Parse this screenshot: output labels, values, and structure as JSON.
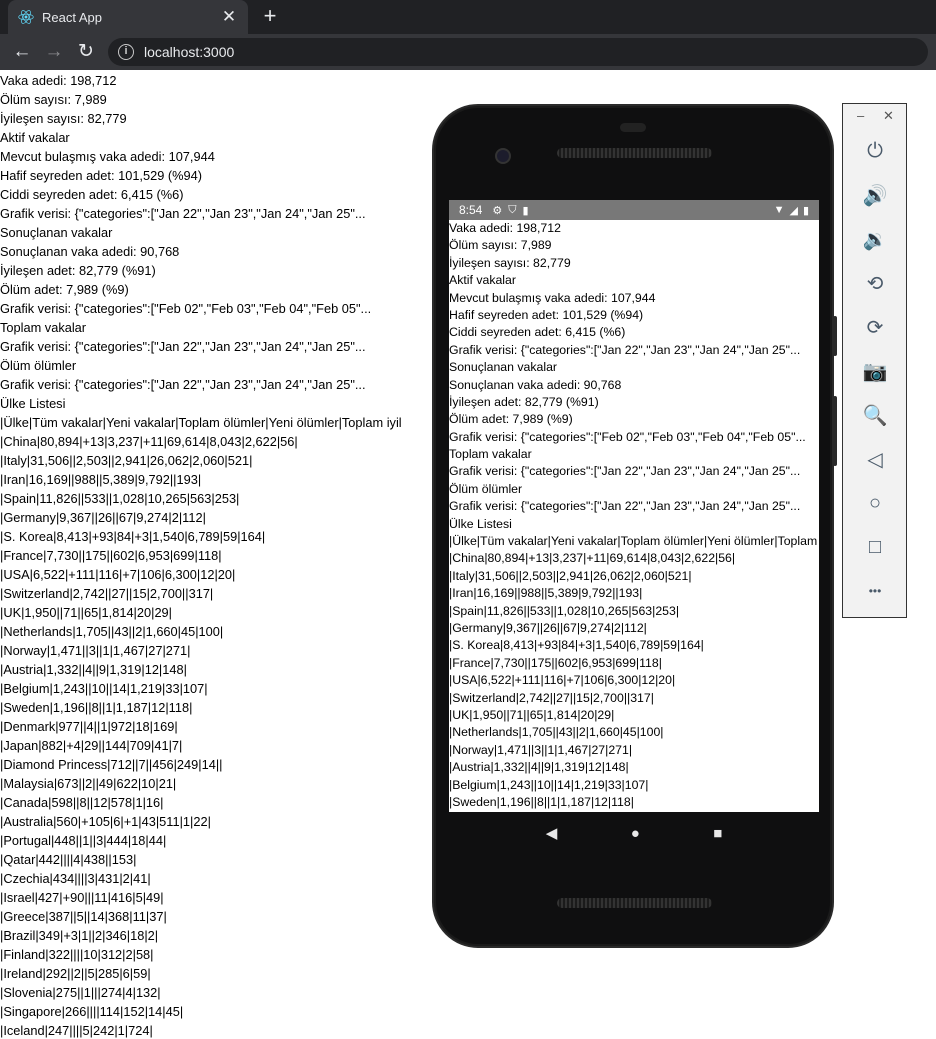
{
  "browser": {
    "tab_title": "React App",
    "tab_close": "✕",
    "new_tab": "+",
    "url": "localhost:3000",
    "back": "←",
    "forward": "→",
    "reload": "↻",
    "info": "i"
  },
  "page": {
    "lines": [
      "Vaka adedi: 198,712",
      "Ölüm sayısı: 7,989",
      "İyileşen sayısı: 82,779",
      "Aktif vakalar",
      "Mevcut bulaşmış vaka adedi: 107,944",
      "Hafif seyreden adet: 101,529 (%94)",
      "Ciddi seyreden adet: 6,415 (%6)",
      "Grafik verisi: {\"categories\":[\"Jan 22\",\"Jan 23\",\"Jan 24\",\"Jan 25\"...",
      "Sonuçlanan vakalar",
      "Sonuçlanan vaka adedi: 90,768",
      "İyileşen adet: 82,779 (%91)",
      "Ölüm adet: 7,989 (%9)",
      "Grafik verisi: {\"categories\":[\"Feb 02\",\"Feb 03\",\"Feb 04\",\"Feb 05\"...",
      "Toplam vakalar",
      "Grafik verisi: {\"categories\":[\"Jan 22\",\"Jan 23\",\"Jan 24\",\"Jan 25\"...",
      "Ölüm ölümler",
      "Grafik verisi: {\"categories\":[\"Jan 22\",\"Jan 23\",\"Jan 24\",\"Jan 25\"...",
      "Ülke Listesi",
      "|Ülke|Tüm vakalar|Yeni vakalar|Toplam ölümler|Yeni ölümler|Toplam iyil",
      "|China|80,894|+13|3,237|+11|69,614|8,043|2,622|56|",
      "|Italy|31,506||2,503||2,941|26,062|2,060|521|",
      "|Iran|16,169||988||5,389|9,792||193|",
      "|Spain|11,826||533||1,028|10,265|563|253|",
      "|Germany|9,367||26||67|9,274|2|112|",
      "|S. Korea|8,413|+93|84|+3|1,540|6,789|59|164|",
      "|France|7,730||175||602|6,953|699|118|",
      "|USA|6,522|+111|116|+7|106|6,300|12|20|",
      "|Switzerland|2,742||27||15|2,700||317|",
      "|UK|1,950||71||65|1,814|20|29|",
      "|Netherlands|1,705||43||2|1,660|45|100|",
      "|Norway|1,471||3||1|1,467|27|271|",
      "|Austria|1,332||4||9|1,319|12|148|",
      "|Belgium|1,243||10||14|1,219|33|107|",
      "|Sweden|1,196||8||1|1,187|12|118|",
      "|Denmark|977||4||1|972|18|169|",
      "|Japan|882|+4|29||144|709|41|7|",
      "|Diamond Princess|712||7||456|249|14||",
      "|Malaysia|673||2||49|622|10|21|",
      "|Canada|598||8||12|578|1|16|",
      "|Australia|560|+105|6|+1|43|511|1|22|",
      "|Portugal|448||1||3|444|18|44|",
      "|Qatar|442||||4|438||153|",
      "|Czechia|434||||3|431|2|41|",
      "|Israel|427|+90|||11|416|5|49|",
      "|Greece|387||5||14|368|11|37|",
      "|Brazil|349|+3|1||2|346|18|2|",
      "|Finland|322||||10|312|2|58|",
      "|Ireland|292||2||5|285|6|59|",
      "|Slovenia|275||1|||274|4|132|",
      "|Singapore|266||||114|152|14|45|",
      "|Iceland|247||||5|242|1|724|"
    ]
  },
  "phone": {
    "status_time": "8:54",
    "status_icons": [
      "gear-icon",
      "shield-icon",
      "sdcard-icon"
    ],
    "status_right": [
      "wifi-icon",
      "signal-icon",
      "battery-icon"
    ],
    "lines": [
      "Vaka adedi: 198,712",
      "Ölüm sayısı: 7,989",
      "İyileşen sayısı: 82,779",
      "Aktif vakalar",
      "Mevcut bulaşmış vaka adedi: 107,944",
      "Hafif seyreden adet: 101,529 (%94)",
      "Ciddi seyreden adet: 6,415 (%6)",
      "Grafik verisi: {\"categories\":[\"Jan 22\",\"Jan 23\",\"Jan 24\",\"Jan 25\"...",
      "Sonuçlanan vakalar",
      "Sonuçlanan vaka adedi: 90,768",
      "İyileşen adet: 82,779 (%91)",
      "Ölüm adet: 7,989 (%9)",
      "Grafik verisi: {\"categories\":[\"Feb 02\",\"Feb 03\",\"Feb 04\",\"Feb 05\"...",
      "Toplam vakalar",
      "Grafik verisi: {\"categories\":[\"Jan 22\",\"Jan 23\",\"Jan 24\",\"Jan 25\"...",
      "Ölüm ölümler",
      "Grafik verisi: {\"categories\":[\"Jan 22\",\"Jan 23\",\"Jan 24\",\"Jan 25\"...",
      "Ülke Listesi",
      "|Ülke|Tüm vakalar|Yeni vakalar|Toplam ölümler|Yeni ölümler|Toplam",
      "|China|80,894|+13|3,237|+11|69,614|8,043|2,622|56|",
      "|Italy|31,506||2,503||2,941|26,062|2,060|521|",
      "|Iran|16,169||988||5,389|9,792||193|",
      "|Spain|11,826||533||1,028|10,265|563|253|",
      "|Germany|9,367||26||67|9,274|2|112|",
      "|S. Korea|8,413|+93|84|+3|1,540|6,789|59|164|",
      "|France|7,730||175||602|6,953|699|118|",
      "|USA|6,522|+111|116|+7|106|6,300|12|20|",
      "|Switzerland|2,742||27||15|2,700||317|",
      "|UK|1,950||71||65|1,814|20|29|",
      "|Netherlands|1,705||43||2|1,660|45|100|",
      "|Norway|1,471||3||1|1,467|27|271|",
      "|Austria|1,332||4||9|1,319|12|148|",
      "|Belgium|1,243||10||14|1,219|33|107|",
      "|Sweden|1,196||8||1|1,187|12|118|"
    ],
    "nav": {
      "back": "◀",
      "home": "●",
      "recents": "■"
    }
  },
  "emulator_panel": {
    "minimize": "–",
    "close": "✕",
    "buttons": [
      {
        "name": "power-icon",
        "glyph": "⏻"
      },
      {
        "name": "volume-up-icon",
        "glyph": "🔊"
      },
      {
        "name": "volume-down-icon",
        "glyph": "🔉"
      },
      {
        "name": "rotate-left-icon",
        "glyph": "⟲"
      },
      {
        "name": "rotate-right-icon",
        "glyph": "⟳"
      },
      {
        "name": "camera-icon",
        "glyph": "📷"
      },
      {
        "name": "zoom-icon",
        "glyph": "🔍"
      },
      {
        "name": "back-icon",
        "glyph": "◁"
      },
      {
        "name": "home-icon",
        "glyph": "○"
      },
      {
        "name": "overview-icon",
        "glyph": "□"
      },
      {
        "name": "more-icon",
        "glyph": "•••"
      }
    ]
  }
}
